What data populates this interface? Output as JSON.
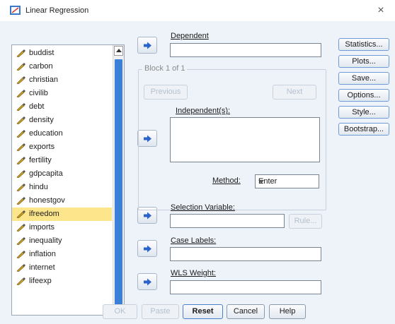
{
  "window": {
    "title": "Linear Regression",
    "close_glyph": "×"
  },
  "variables": {
    "items": [
      "buddist",
      "carbon",
      "christian",
      "civilib",
      "debt",
      "density",
      "education",
      "exports",
      "fertility",
      "gdpcapita",
      "hindu",
      "honestgov",
      "ifreedom",
      "imports",
      "inequality",
      "inflation",
      "internet",
      "lifeexp"
    ],
    "selected": "ifreedom"
  },
  "dependent": {
    "label": "Dependent",
    "value": ""
  },
  "block": {
    "title": "Block 1 of 1",
    "previous_label": "Previous",
    "next_label": "Next",
    "independent_label": "Independent(s):",
    "method_label": "Method:",
    "method_value": "Enter"
  },
  "selection": {
    "label": "Selection Variable:",
    "rule_label": "Rule..."
  },
  "case_labels": {
    "label": "Case Labels:"
  },
  "wls": {
    "label": "WLS Weight:"
  },
  "side_buttons": {
    "statistics": "Statistics...",
    "plots": "Plots...",
    "save": "Save...",
    "options": "Options...",
    "style": "Style...",
    "bootstrap": "Bootstrap..."
  },
  "bottom_buttons": {
    "ok": "OK",
    "paste": "Paste",
    "reset": "Reset",
    "cancel": "Cancel",
    "help": "Help"
  },
  "colors": {
    "accent": "#3a7fd8",
    "selection": "#fde58c",
    "arrow": "#2a63c9"
  },
  "icons": {
    "variable": "ruler-pencil-icon",
    "move": "arrow-right-icon",
    "app": "spss-regression-icon"
  }
}
